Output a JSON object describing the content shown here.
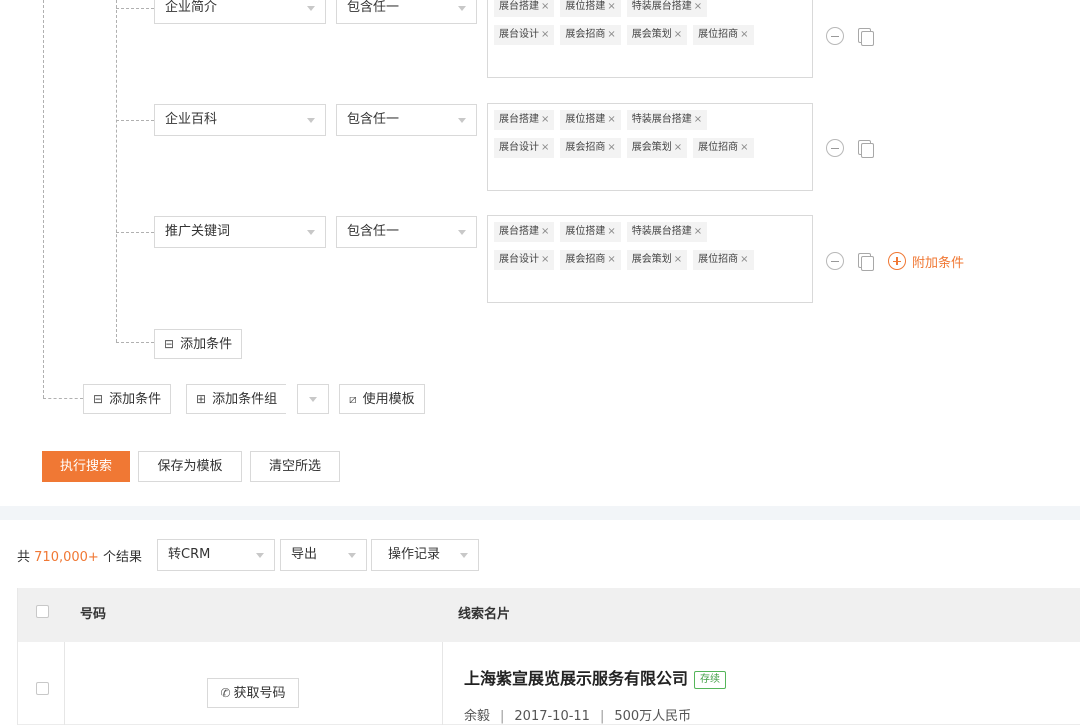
{
  "conditions": [
    {
      "field": "企业简介",
      "operator": "包含任一",
      "tags_row1": [
        "展台搭建",
        "展位搭建",
        "特装展台搭建"
      ],
      "tags_row2": [
        "展台设计",
        "展会招商",
        "展会策划",
        "展位招商"
      ],
      "show_add_extra": false
    },
    {
      "field": "企业百科",
      "operator": "包含任一",
      "tags_row1": [
        "展台搭建",
        "展位搭建",
        "特装展台搭建"
      ],
      "tags_row2": [
        "展台设计",
        "展会招商",
        "展会策划",
        "展位招商"
      ],
      "show_add_extra": false
    },
    {
      "field": "推广关键词",
      "operator": "包含任一",
      "tags_row1": [
        "展台搭建",
        "展位搭建",
        "特装展台搭建"
      ],
      "tags_row2": [
        "展台设计",
        "展会招商",
        "展会策划",
        "展位招商"
      ],
      "show_add_extra": true
    }
  ],
  "tag_remove_glyph": "×",
  "add_extra_label": "附加条件",
  "inner_add_condition_label": "添加条件",
  "outer_toolbar": {
    "add_condition_label": "添加条件",
    "add_group_label": "添加条件组",
    "use_template_label": "使用模板"
  },
  "actions": {
    "search_label": "执行搜索",
    "save_template_label": "保存为模板",
    "clear_label": "清空所选"
  },
  "results": {
    "prefix": "共",
    "count": "710,000+",
    "suffix": "个结果",
    "crm_label": "转CRM",
    "export_label": "导出",
    "history_label": "操作记录"
  },
  "table": {
    "headers": {
      "number": "号码",
      "lead_name": "线索名片"
    },
    "rows": [
      {
        "get_number_label": "获取号码",
        "company": "上海紫宣展览展示服务有限公司",
        "status": "存续",
        "person": "余毅",
        "date": "2017-10-11",
        "capital": "500万人民币"
      }
    ]
  },
  "colors": {
    "accent": "#f07834",
    "status_green": "#43a047",
    "header_bg": "#f0f0f0"
  },
  "icons": {
    "remove_condition": "minus-circle-icon",
    "copy_condition": "copy-icon",
    "add_extra": "plus-circle-icon",
    "add_condition": "add-condition-icon",
    "add_group": "add-group-icon",
    "template": "template-icon",
    "phone": "phone-icon"
  }
}
